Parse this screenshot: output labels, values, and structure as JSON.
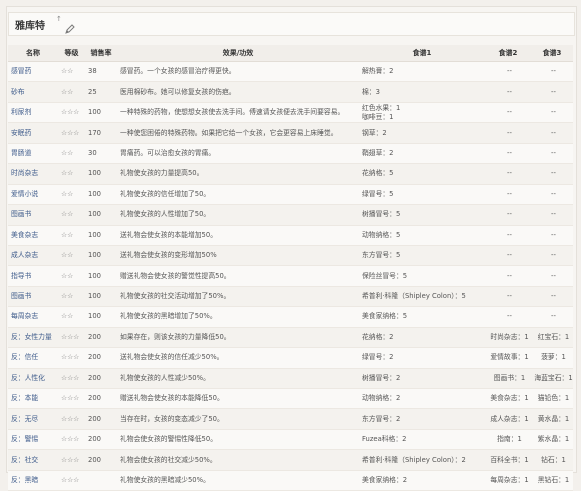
{
  "title": "雅库特",
  "table": {
    "headers": [
      "名称",
      "等级",
      "销售率",
      "效果/功效",
      "食谱1",
      "食谱2",
      "食谱3"
    ],
    "rows": [
      {
        "name": "感冒药",
        "stars": "☆☆",
        "price": "38",
        "effect": "感冒药。一个女孩的感冒治疗得更快。",
        "r1": "解热膏：2",
        "r2": "--",
        "r3": "--"
      },
      {
        "name": "砂布",
        "stars": "☆☆",
        "price": "25",
        "effect": "医用棉砂布。她可以修复女孩的伤疤。",
        "r1": "棉：3",
        "r2": "--",
        "r3": "--"
      },
      {
        "name": "利尿剂",
        "stars": "☆☆☆",
        "price": "100",
        "effect": "一种特殊的药物，使想想女孩使去洗手间。傅速请女孩便去洗手间要容易。",
        "r1": "红色水果：1\n咖啡豆：1",
        "r2": "--",
        "r3": "--"
      },
      {
        "name": "安眠药",
        "stars": "☆☆☆",
        "price": "170",
        "effect": "一种使您困倦的特殊药物。如果把它给一个女孩，它会更容易上床睡觉。",
        "r1": "钢草：2",
        "r2": "--",
        "r3": "--"
      },
      {
        "name": "胃肠道",
        "stars": "☆☆",
        "price": "30",
        "effect": "胃痛药。可以治愈女孩的胃痛。",
        "r1": "鞘翅草：2",
        "r2": "--",
        "r3": "--"
      },
      {
        "name": "时尚杂志",
        "stars": "☆☆",
        "price": "100",
        "effect": "礼物使女孩的力量提高50。",
        "r1": "花纳格：5",
        "r2": "--",
        "r3": "--"
      },
      {
        "name": "爱情小说",
        "stars": "☆☆",
        "price": "100",
        "effect": "礼物使女孩的信任增加了50。",
        "r1": "绿冒号：5",
        "r2": "--",
        "r3": "--"
      },
      {
        "name": "图画书",
        "stars": "☆☆",
        "price": "100",
        "effect": "礼物使女孩的人性增加了50。",
        "r1": "树播冒号：5",
        "r2": "--",
        "r3": "--"
      },
      {
        "name": "美食杂志",
        "stars": "☆☆",
        "price": "100",
        "effect": "送礼物会使女孩的本能增加50。",
        "r1": "动物纳格：5",
        "r2": "--",
        "r3": "--"
      },
      {
        "name": "成人杂志",
        "stars": "☆☆",
        "price": "100",
        "effect": "送礼物会使女孩的变形增加50%",
        "r1": "东方冒号：5",
        "r2": "--",
        "r3": "--"
      },
      {
        "name": "指导书",
        "stars": "☆☆",
        "price": "100",
        "effect": "赠送礼物会使女孩的警觉性提高50。",
        "r1": "保险丝冒号：5",
        "r2": "--",
        "r3": "--"
      },
      {
        "name": "图画书",
        "stars": "☆☆",
        "price": "100",
        "effect": "礼物使女孩的社交活动增加了50%。",
        "r1": "希普利·科隆（Shipley Colon）：5",
        "r2": "--",
        "r3": "--"
      },
      {
        "name": "每周杂志",
        "stars": "☆☆",
        "price": "100",
        "effect": "礼物使女孩的黑暗增加了50%。",
        "r1": "美食家纳格：5",
        "r2": "--",
        "r3": "--"
      },
      {
        "name": "反：女性力量",
        "stars": "☆☆☆",
        "price": "200",
        "effect": "如果存在，则该女孩的力量降低50。",
        "r1": "花纳格：2",
        "r2": "时尚杂志：1",
        "r3": "红宝石：1"
      },
      {
        "name": "反：信任",
        "stars": "☆☆☆",
        "price": "200",
        "effect": "送礼物会使女孩的信任减少50%。",
        "r1": "绿冒号：2",
        "r2": "爱情故事：1",
        "r3": "菠萝：1"
      },
      {
        "name": "反：人性化",
        "stars": "☆☆☆",
        "price": "200",
        "effect": "礼物使女孩的人性减少50%。",
        "r1": "树播冒号：2",
        "r2": "图画书：1",
        "r3": "海蓝宝石：1"
      },
      {
        "name": "反：本能",
        "stars": "☆☆☆",
        "price": "200",
        "effect": "赠送礼物会使女孩的本能降低50。",
        "r1": "动物纳格：2",
        "r2": "美食杂志：1",
        "r3": "猫铅色：1"
      },
      {
        "name": "反：无尽",
        "stars": "☆☆☆",
        "price": "200",
        "effect": "当存在时，女孩的变态减少了50。",
        "r1": "东方冒号：2",
        "r2": "成人杂志：1",
        "r3": "黄水晶：1"
      },
      {
        "name": "反：警惕",
        "stars": "☆☆☆",
        "price": "200",
        "effect": "礼物会使女孩的警惕性降低50。",
        "r1": "Fuzea科格：2",
        "r2": "指南：1",
        "r3": "紫水晶：1"
      },
      {
        "name": "反：社交",
        "stars": "☆☆☆",
        "price": "200",
        "effect": "礼物会使女孩的社交减少50%。",
        "r1": "希普利·科隆（Shipley Colon）：2",
        "r2": "百科全书：1",
        "r3": "钻石：1"
      },
      {
        "name": "反：黑暗",
        "stars": "☆☆☆",
        "price": "",
        "effect": "礼物使女孩的黑暗减少50%。",
        "r1": "美食家纳格：2",
        "r2": "每周杂志：1",
        "r3": "黑钻石：1"
      }
    ]
  }
}
